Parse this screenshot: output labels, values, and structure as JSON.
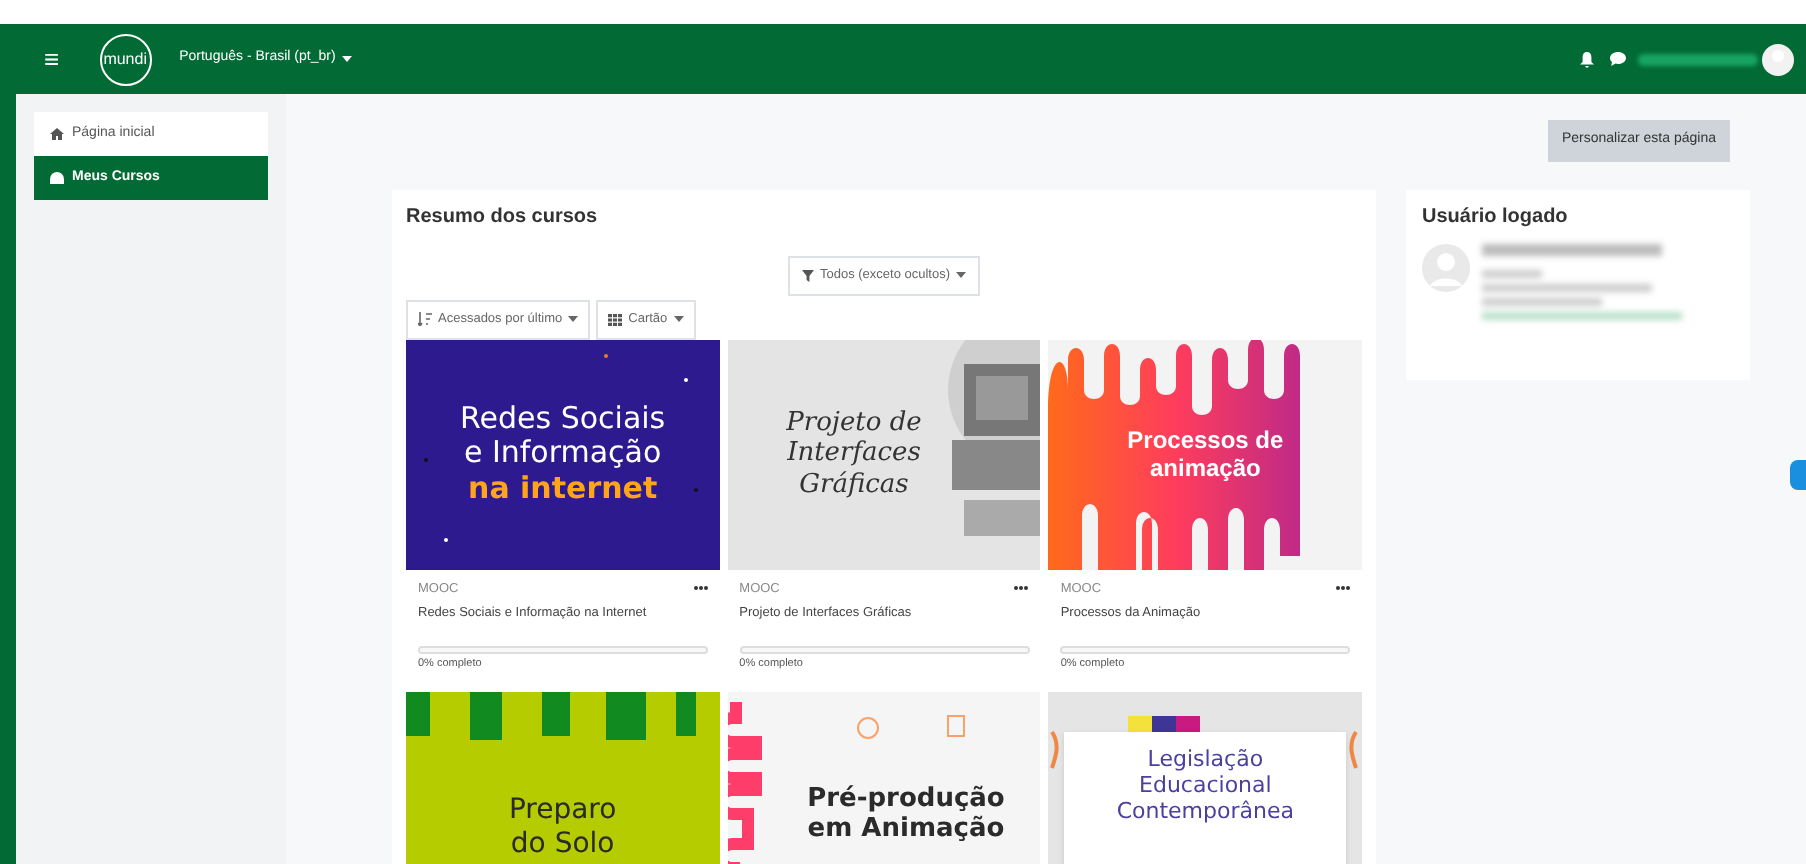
{
  "navbar": {
    "menu_glyph": "≡",
    "logo": "mundi",
    "language": "Português - Brasil (pt_br)"
  },
  "sidebar": {
    "items": [
      {
        "label": "Página inicial",
        "selected": false
      },
      {
        "label": "Meus Cursos",
        "selected": true
      }
    ]
  },
  "customize_button": "Personalizar esta página",
  "course_overview": {
    "title": "Resumo dos cursos",
    "filter": "Todos (exceto ocultos)",
    "sort": "Acessados por último",
    "view": "Cartão",
    "courses": [
      {
        "banner": {
          "kind": "space",
          "lines": [
            {
              "text": "Redes Sociais",
              "accent": false
            },
            {
              "text": "e Informação",
              "accent": false
            },
            {
              "text": "na internet",
              "accent": true
            }
          ]
        },
        "category": "MOOC",
        "name": "Redes Sociais e Informação na Internet",
        "level": 0,
        "progress": "0% completo"
      },
      {
        "banner": {
          "kind": "retro",
          "lines": [
            {
              "text": "Projeto de",
              "accent": false
            },
            {
              "text": "Interfaces",
              "accent": false
            },
            {
              "text": "Gráficas",
              "accent": false
            }
          ]
        },
        "category": "MOOC",
        "name": "Projeto de Interfaces Gráficas",
        "level": 0,
        "progress": "0% completo"
      },
      {
        "banner": {
          "kind": "drips",
          "lines": [
            {
              "text": "Processos de",
              "accent": false
            },
            {
              "text": "animação",
              "accent": false
            }
          ]
        },
        "category": "MOOC",
        "name": "Processos da Animação",
        "level": 0,
        "progress": "0% completo"
      },
      {
        "banner": {
          "kind": "stripes",
          "lines": [
            {
              "text": "Preparo",
              "accent": false
            },
            {
              "text": "do Solo",
              "accent": false
            }
          ]
        }
      },
      {
        "banner": {
          "kind": "squiggle",
          "lines": [
            {
              "text": "Pré-produção",
              "accent": false
            },
            {
              "text": "em Animação",
              "accent": false
            }
          ]
        }
      },
      {
        "banner": {
          "kind": "frame",
          "lines": [
            {
              "text": "Legislação",
              "accent": false
            },
            {
              "text": "Educacional",
              "accent": false
            },
            {
              "text": "Contemporânea",
              "accent": false
            }
          ]
        }
      }
    ]
  },
  "user_block": {
    "title": "Usuário logado"
  }
}
